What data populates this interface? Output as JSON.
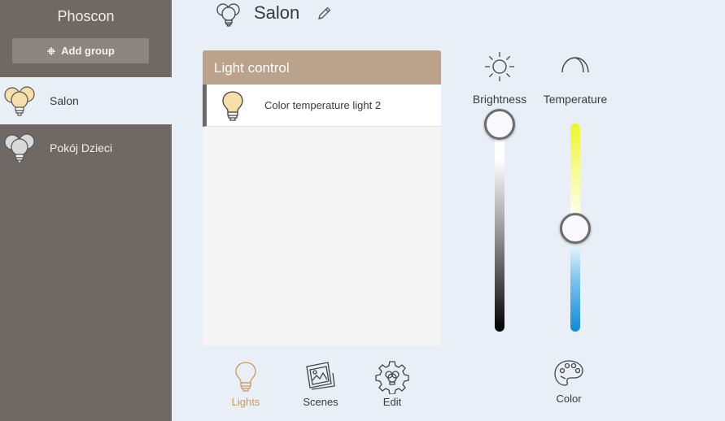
{
  "sidebar": {
    "brand": "Phoscon",
    "add_group_label": "Add group",
    "groups": [
      {
        "label": "Salon",
        "active": true
      },
      {
        "label": "Pokój Dzieci",
        "active": false
      }
    ]
  },
  "header": {
    "title": "Salon"
  },
  "light_control": {
    "title": "Light control",
    "lights": [
      {
        "label": "Color temperature light 2"
      }
    ]
  },
  "controls": {
    "brightness": {
      "label": "Brightness",
      "value_fraction": 1.0
    },
    "temperature": {
      "label": "Temperature",
      "value_fraction": 0.5
    },
    "color": {
      "label": "Color"
    }
  },
  "bottom_nav": {
    "lights_label": "Lights",
    "scenes_label": "Scenes",
    "edit_label": "Edit",
    "active": "lights"
  },
  "colors": {
    "sidebar_bg": "#6e6965",
    "panel_header_bg": "#baa38a",
    "accent_active": "#c99a62",
    "page_bg": "#e8eff7"
  }
}
